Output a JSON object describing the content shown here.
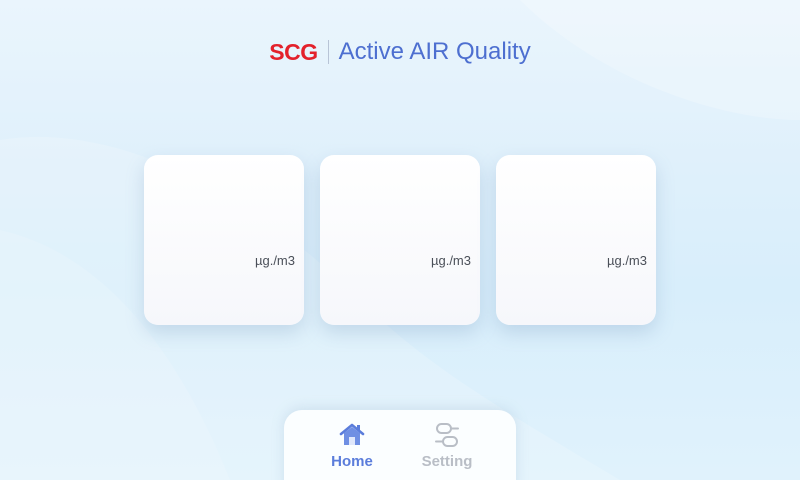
{
  "header": {
    "brand": "SCG",
    "title": "Active AIR Quality"
  },
  "cards": [
    {
      "unit": "µg./m3"
    },
    {
      "unit": "µg./m3"
    },
    {
      "unit": "µg./m3"
    }
  ],
  "nav": {
    "items": [
      {
        "label": "Home",
        "icon": "home-icon",
        "active": true
      },
      {
        "label": "Setting",
        "icon": "settings-icon",
        "active": false
      }
    ]
  },
  "colors": {
    "brand": "#e3212b",
    "title": "#4d6fd0",
    "nav_active": "#5b7ddb",
    "nav_inactive": "#b9bec6"
  }
}
